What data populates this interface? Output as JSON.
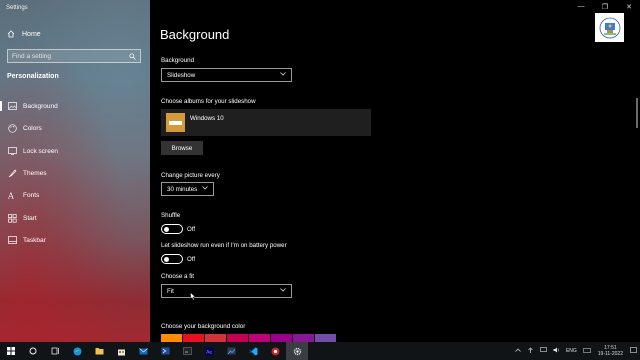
{
  "window": {
    "title": "Settings",
    "controls": [
      "—",
      "❐",
      "✕"
    ]
  },
  "sidebar": {
    "home_label": "Home",
    "search_placeholder": "Find a setting",
    "section_label": "Personalization",
    "items": [
      {
        "label": "Background",
        "icon": "image-icon",
        "active": true
      },
      {
        "label": "Colors",
        "icon": "palette-icon"
      },
      {
        "label": "Lock screen",
        "icon": "lock-screen-icon"
      },
      {
        "label": "Themes",
        "icon": "brush-icon"
      },
      {
        "label": "Fonts",
        "icon": "font-icon"
      },
      {
        "label": "Start",
        "icon": "start-icon"
      },
      {
        "label": "Taskbar",
        "icon": "taskbar-icon"
      }
    ]
  },
  "main": {
    "title": "Background",
    "background_label": "Background",
    "background_value": "Slideshow",
    "albums_label": "Choose albums for your slideshow",
    "album_name": "Windows 10",
    "browse_label": "Browse",
    "change_picture_label": "Change picture every",
    "change_picture_value": "30 minutes",
    "shuffle_label": "Shuffle",
    "shuffle_state": "Off",
    "battery_label": "Let slideshow run even if I'm on battery power",
    "battery_state": "Off",
    "fit_label": "Choose a fit",
    "fit_value": "Fit",
    "bg_color_label": "Choose your background color",
    "color_swatches": [
      "#ff8c00",
      "#e81123",
      "#d13438",
      "#c30052",
      "#bf0077",
      "#9a0089",
      "#881798",
      "#744da9"
    ]
  },
  "taskbar": {
    "tray_lang": "ENG",
    "time": "17:51",
    "date": "19-11-2022"
  }
}
